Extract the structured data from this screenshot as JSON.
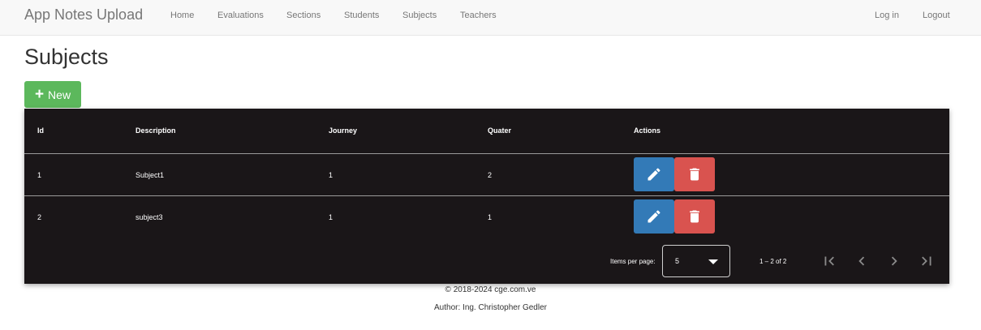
{
  "navbar": {
    "brand": "App Notes Upload",
    "links": [
      "Home",
      "Evaluations",
      "Sections",
      "Students",
      "Subjects",
      "Teachers"
    ],
    "login": "Log in",
    "logout": "Logout"
  },
  "page": {
    "title": "Subjects",
    "new_label": "New"
  },
  "table": {
    "headers": [
      "Id",
      "Description",
      "Journey",
      "Quater",
      "Actions"
    ],
    "rows": [
      {
        "id": "1",
        "description": "Subject1",
        "journey": "1",
        "quater": "2"
      },
      {
        "id": "2",
        "description": "subject3",
        "journey": "1",
        "quater": "1"
      }
    ],
    "action_icons": [
      "pencil-icon",
      "trash-icon"
    ]
  },
  "paginator": {
    "items_per_page_label": "Items per page:",
    "page_size": "5",
    "range_label": "1 – 2 of 2"
  },
  "footer": {
    "copyright": "© 2018-2024 cge.com.ve",
    "author": "Author: Ing. Christopher Gedler"
  },
  "colors": {
    "new_button": "#5cb85c",
    "edit_button": "#337ab7",
    "delete_button": "#d9534f",
    "table_background": "#1a1618"
  }
}
